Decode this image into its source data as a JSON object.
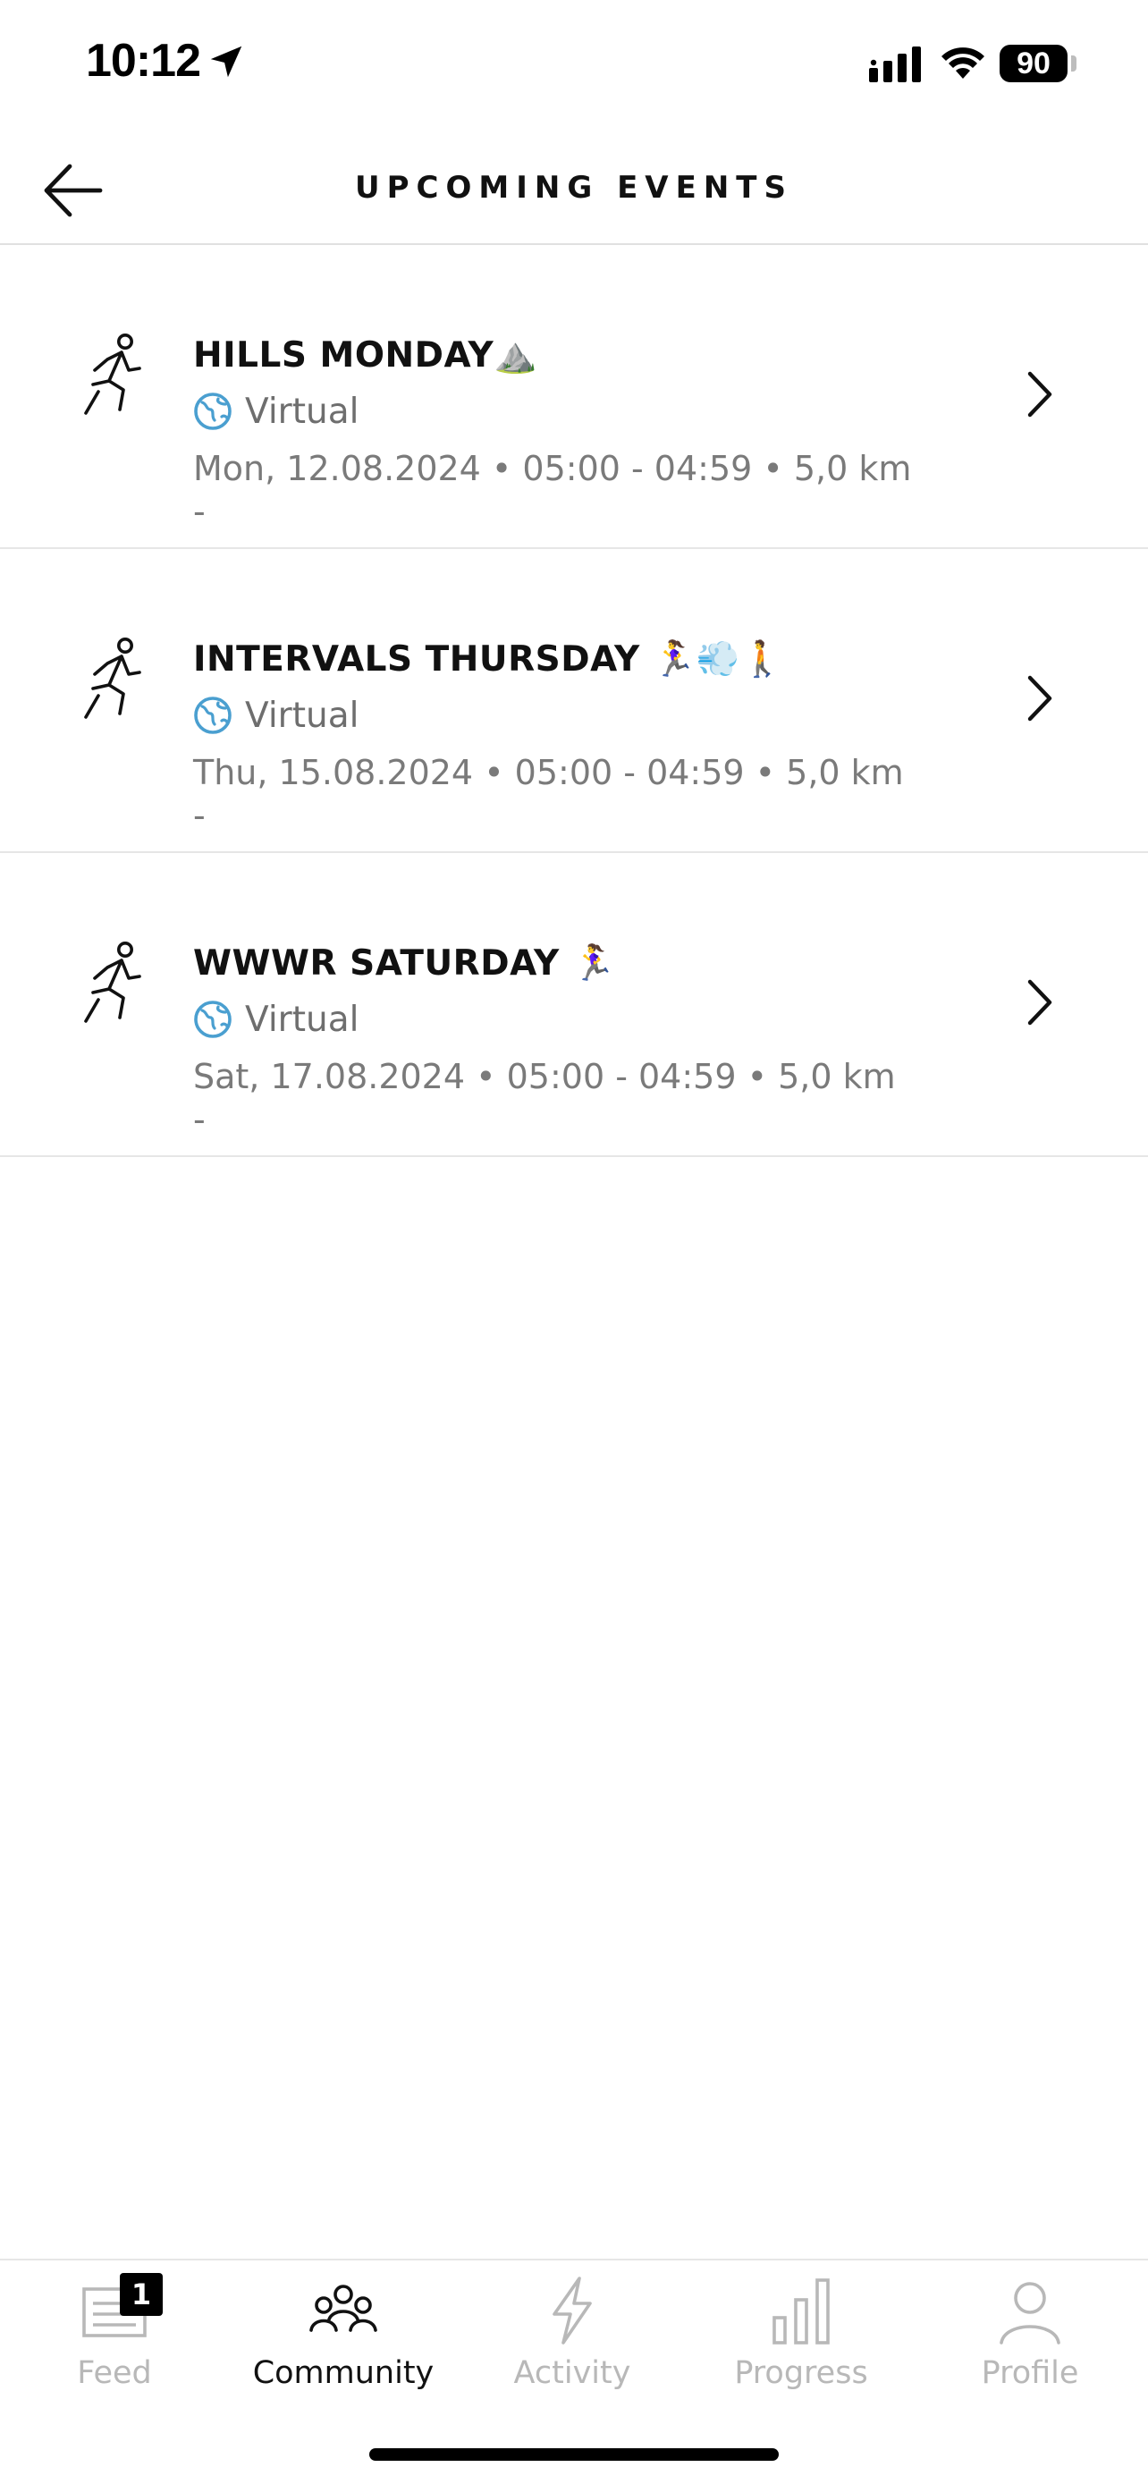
{
  "status_bar": {
    "time": "10:12",
    "battery": "90"
  },
  "header": {
    "title": "UPCOMING EVENTS"
  },
  "events": [
    {
      "title": "HILLS  MONDAY⛰️",
      "location": "Virtual",
      "meta": "Mon, 12.08.2024 • 05:00 - 04:59 • 5,0 km",
      "extra": "-"
    },
    {
      "title": "INTERVALS THURSDAY 🏃‍♀️💨🚶",
      "location": "Virtual",
      "meta": "Thu, 15.08.2024 • 05:00 - 04:59 • 5,0 km",
      "extra": "-"
    },
    {
      "title": "WWWR SATURDAY 🏃‍♀️",
      "location": "Virtual",
      "meta": "Sat, 17.08.2024 • 05:00 - 04:59 • 5,0 km",
      "extra": "-"
    }
  ],
  "tabs": [
    {
      "label": "Feed",
      "icon": "feed-icon",
      "badge": "1",
      "active": false
    },
    {
      "label": "Community",
      "icon": "community-icon",
      "active": true
    },
    {
      "label": "Activity",
      "icon": "lightning-icon",
      "active": false
    },
    {
      "label": "Progress",
      "icon": "bar-chart-icon",
      "active": false
    },
    {
      "label": "Profile",
      "icon": "person-icon",
      "active": false
    }
  ],
  "colors": {
    "accent": "#000000",
    "muted_text": "#7a7a7a",
    "inactive_tab": "#b8b8b8",
    "globe": "#4a9fd0"
  }
}
